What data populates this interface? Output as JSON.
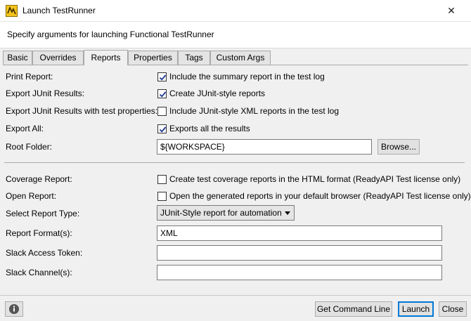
{
  "window": {
    "title": "Launch TestRunner",
    "close_glyph": "✕",
    "icons": {
      "app": "testrunner-app-icon",
      "close": "close-icon"
    }
  },
  "header": {
    "text": "Specify arguments for launching Functional TestRunner"
  },
  "tabs": [
    {
      "label": "Basic",
      "active": false
    },
    {
      "label": "Overrides",
      "active": false
    },
    {
      "label": "Reports",
      "active": true
    },
    {
      "label": "Properties",
      "active": false
    },
    {
      "label": "Tags",
      "active": false
    },
    {
      "label": "Custom Args",
      "active": false
    }
  ],
  "reports": {
    "print_report": {
      "label": "Print Report:",
      "checkbox_label": "Include the summary report in the test log",
      "checked": true
    },
    "export_junit": {
      "label": "Export JUnit Results:",
      "checkbox_label": "Create JUnit-style reports",
      "checked": true
    },
    "export_junit_props": {
      "label": "Export JUnit Results with test properties:",
      "checkbox_label": "Include JUnit-style XML reports in the test log",
      "checked": false
    },
    "export_all": {
      "label": "Export All:",
      "checkbox_label": "Exports all the results",
      "checked": true
    },
    "root_folder": {
      "label": "Root Folder:",
      "value": "${WORKSPACE}",
      "browse_label": "Browse..."
    },
    "coverage_report": {
      "label": "Coverage Report:",
      "checkbox_label": "Create test coverage reports in the HTML format (ReadyAPI Test license only)",
      "checked": false
    },
    "open_report": {
      "label": "Open Report:",
      "checkbox_label": "Open the generated reports in your default browser (ReadyAPI Test license only)",
      "checked": false
    },
    "report_type": {
      "label": "Select Report Type:",
      "selected": "JUnit-Style report for automation"
    },
    "report_formats": {
      "label": "Report Format(s):",
      "value": "XML"
    },
    "slack_token": {
      "label": "Slack Access Token:",
      "value": ""
    },
    "slack_channels": {
      "label": "Slack Channel(s):",
      "value": ""
    }
  },
  "footer": {
    "info_icon": "info-icon",
    "get_command_line_label": "Get Command Line",
    "launch_label": "Launch",
    "close_label": "Close"
  },
  "colors": {
    "checkmark": "#1f3a93",
    "default_button_border": "#0078d7",
    "info_icon": "#555555"
  }
}
